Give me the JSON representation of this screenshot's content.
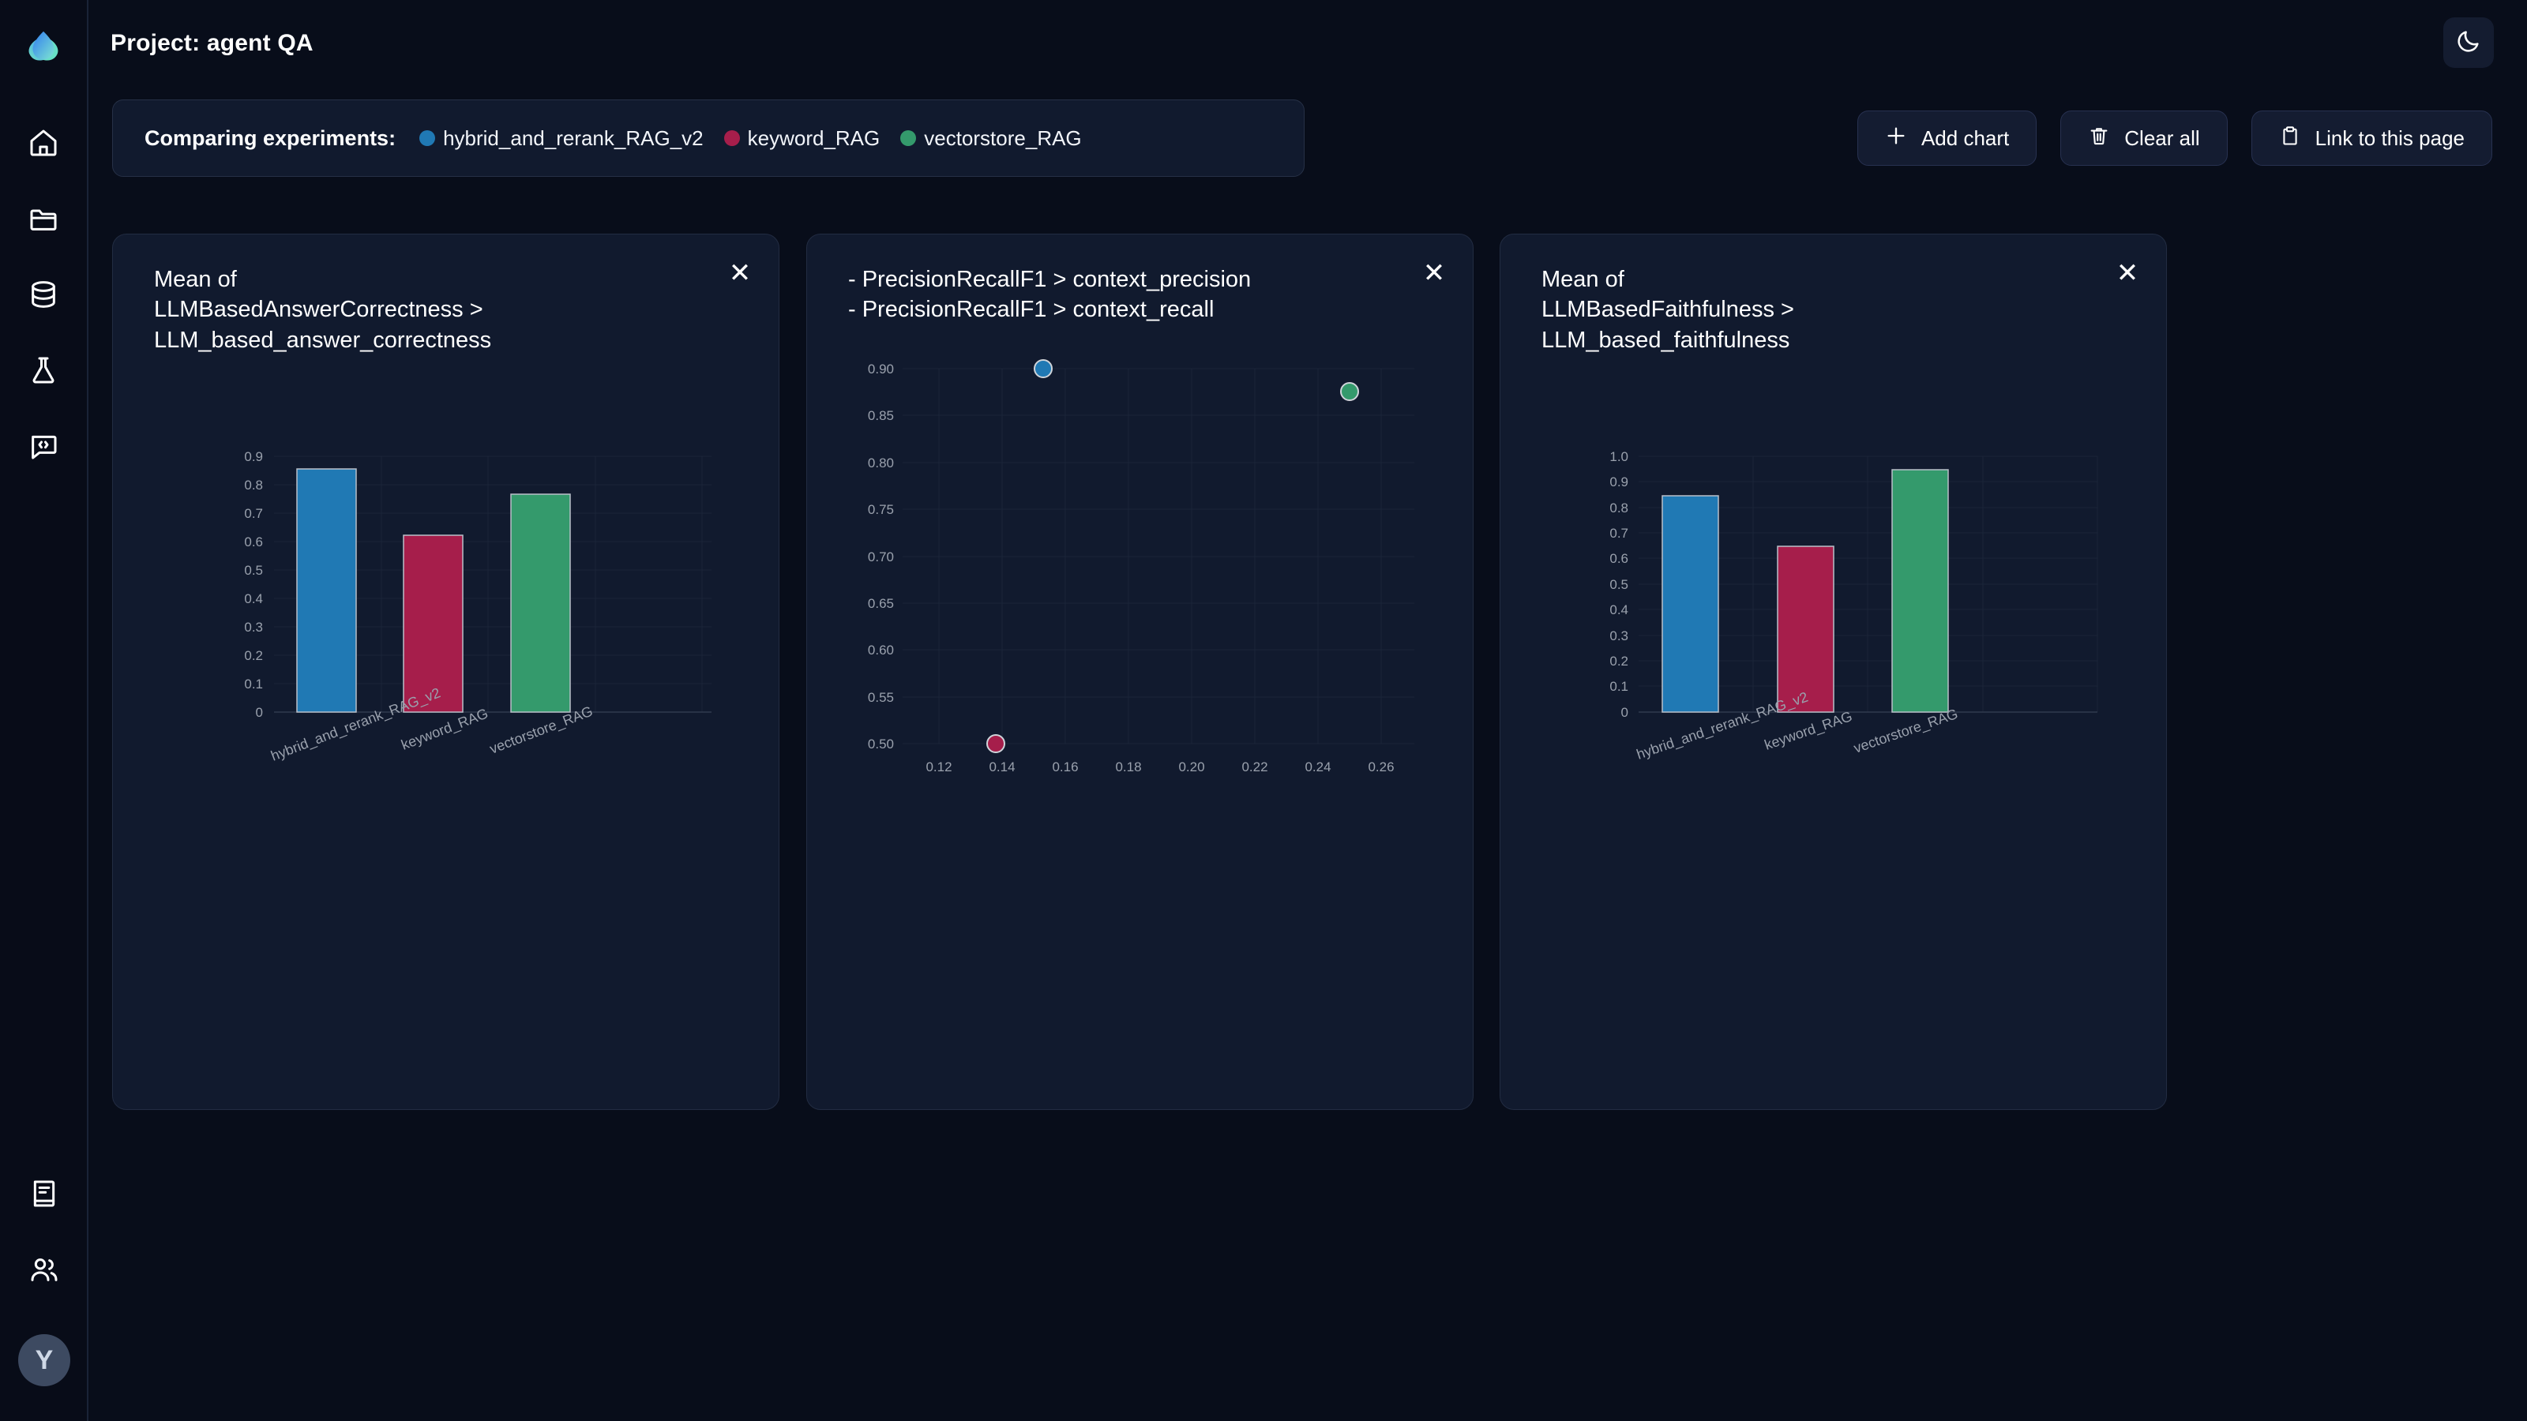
{
  "app": {
    "background": "#080d1a",
    "card_bg": "#111a2e",
    "accent_blue": "#2079b4",
    "accent_crimson": "#a61e4b",
    "accent_green": "#349a6c"
  },
  "header": {
    "title": "Project: agent QA",
    "theme_toggle_icon": "moon-icon"
  },
  "sidebar": {
    "logo_icon": "app-logo-droplet-icon",
    "items": [
      {
        "icon": "home-icon"
      },
      {
        "icon": "folder-icon"
      },
      {
        "icon": "database-icon"
      },
      {
        "icon": "flask-icon"
      },
      {
        "icon": "message-code-icon"
      }
    ],
    "bottom_items": [
      {
        "icon": "book-icon"
      },
      {
        "icon": "users-icon"
      }
    ],
    "avatar_initial": "Y"
  },
  "compare": {
    "label": "Comparing experiments:",
    "experiments": [
      {
        "name": "hybrid_and_rerank_RAG_v2",
        "color": "#2079b4"
      },
      {
        "name": "keyword_RAG",
        "color": "#a61e4b"
      },
      {
        "name": "vectorstore_RAG",
        "color": "#349a6c"
      }
    ]
  },
  "actions": [
    {
      "label": "Add chart",
      "icon": "plus-icon"
    },
    {
      "label": "Clear all",
      "icon": "trash-icon"
    },
    {
      "label": "Link to this page",
      "icon": "clipboard-icon"
    }
  ],
  "cards": [
    {
      "title": "Mean of\nLLMBasedAnswerCorrectness >\nLLM_based_answer_correctness",
      "close_icon": "close-icon"
    },
    {
      "title": "- PrecisionRecallF1 > context_precision\n- PrecisionRecallF1 > context_recall",
      "close_icon": "close-icon"
    },
    {
      "title": "Mean of\nLLMBasedFaithfulness >\nLLM_based_faithfulness",
      "close_icon": "close-icon"
    }
  ],
  "chart_data": [
    {
      "type": "bar",
      "title": "Mean of LLMBasedAnswerCorrectness > LLM_based_answer_correctness",
      "categories": [
        "hybrid_and_rerank_RAG_v2",
        "keyword_RAG",
        "vectorstore_RAG"
      ],
      "values": [
        0.855,
        0.623,
        0.767
      ],
      "colors": [
        "#2079b4",
        "#a61e4b",
        "#349a6c"
      ],
      "xlabel": "",
      "ylabel": "",
      "ylim": [
        0,
        0.9
      ],
      "yticks": [
        "0",
        "0.1",
        "0.2",
        "0.3",
        "0.4",
        "0.5",
        "0.6",
        "0.7",
        "0.8",
        "0.9"
      ],
      "grid": true,
      "legend": "none"
    },
    {
      "type": "scatter",
      "title": "- PrecisionRecallF1 > context_precision  /  - PrecisionRecallF1 > context_recall",
      "xlabel": "context_precision",
      "ylabel": "context_recall",
      "xlim": [
        0.112,
        0.272
      ],
      "ylim": [
        0.5,
        0.915
      ],
      "xticks": [
        "0.12",
        "0.14",
        "0.16",
        "0.18",
        "0.20",
        "0.22",
        "0.24",
        "0.26"
      ],
      "yticks": [
        "0.50",
        "0.55",
        "0.60",
        "0.65",
        "0.70",
        "0.75",
        "0.80",
        "0.85",
        "0.90"
      ],
      "grid": true,
      "legend": "none",
      "points": [
        {
          "name": "hybrid_and_rerank_RAG_v2",
          "x": 0.153,
          "y": 0.9,
          "color": "#2079b4"
        },
        {
          "name": "keyword_RAG",
          "x": 0.138,
          "y": 0.5,
          "color": "#a61e4b"
        },
        {
          "name": "vectorstore_RAG",
          "x": 0.25,
          "y": 0.875,
          "color": "#349a6c"
        }
      ]
    },
    {
      "type": "bar",
      "title": "Mean of LLMBasedFaithfulness > LLM_based_faithfulness",
      "categories": [
        "hybrid_and_rerank_RAG_v2",
        "keyword_RAG",
        "vectorstore_RAG"
      ],
      "values": [
        0.845,
        0.648,
        0.948
      ],
      "colors": [
        "#2079b4",
        "#a61e4b",
        "#349a6c"
      ],
      "xlabel": "",
      "ylabel": "",
      "ylim": [
        0,
        1.0
      ],
      "yticks": [
        "0",
        "0.1",
        "0.2",
        "0.3",
        "0.4",
        "0.5",
        "0.6",
        "0.7",
        "0.8",
        "0.9",
        "1.0"
      ],
      "grid": true,
      "legend": "none"
    }
  ]
}
